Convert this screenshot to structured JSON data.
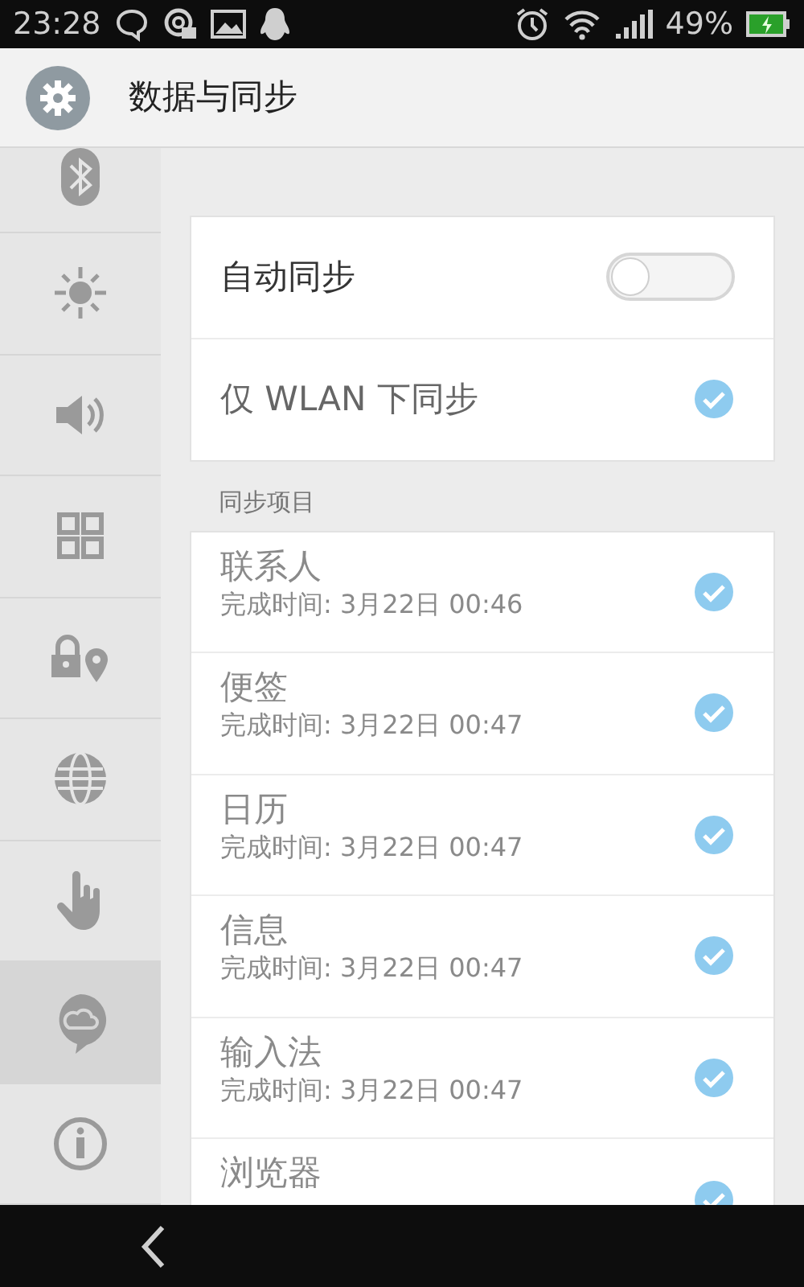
{
  "status_bar": {
    "time": "23:28",
    "battery": "49%"
  },
  "header": {
    "title": "数据与同步"
  },
  "sidebar": {
    "items": [
      {
        "selected": false
      },
      {
        "selected": false
      },
      {
        "selected": false
      },
      {
        "selected": false
      },
      {
        "selected": false
      },
      {
        "selected": false
      },
      {
        "selected": false
      },
      {
        "selected": true
      },
      {
        "selected": false
      }
    ]
  },
  "settings": [
    {
      "kind": "toggle",
      "label": "自动同步",
      "on": false
    },
    {
      "kind": "check",
      "label": "仅 WLAN 下同步",
      "checked": true
    }
  ],
  "section_label": "同步项目",
  "sync_items": [
    {
      "name": "联系人",
      "detail": "完成时间: 3月22日 00:46",
      "checked": true
    },
    {
      "name": "便签",
      "detail": "完成时间: 3月22日 00:47",
      "checked": true
    },
    {
      "name": "日历",
      "detail": "完成时间: 3月22日 00:47",
      "checked": true
    },
    {
      "name": "信息",
      "detail": "完成时间: 3月22日 00:47",
      "checked": true
    },
    {
      "name": "输入法",
      "detail": "完成时间: 3月22日 00:47",
      "checked": true
    },
    {
      "name": "浏览器",
      "checked": true
    }
  ]
}
